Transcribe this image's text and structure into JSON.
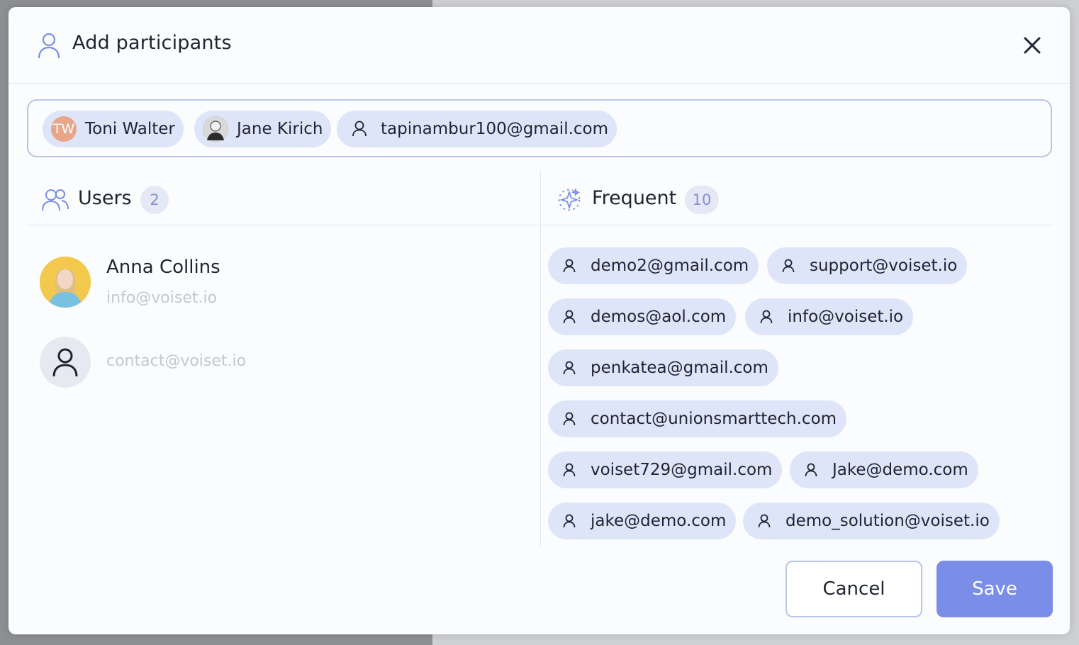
{
  "dialog": {
    "title": "Add participants",
    "close_icon": "close-icon"
  },
  "selected": [
    {
      "initials": "TW",
      "label": "Toni Walter"
    },
    {
      "label": "Jane Kirich"
    },
    {
      "label": "tapinambur100@gmail.com"
    }
  ],
  "users": {
    "title": "Users",
    "count": "2",
    "items": [
      {
        "name": "Anna Collins",
        "email": "info@voiset.io"
      },
      {
        "name": "",
        "email": "contact@voiset.io"
      }
    ]
  },
  "frequent": {
    "title": "Frequent",
    "count": "10",
    "items": [
      "demo2@gmail.com",
      "support@voiset.io",
      "demos@aol.com",
      "info@voiset.io",
      "penkatea@gmail.com",
      "contact@unionsmarttech.com",
      "voiset729@gmail.com",
      "Jake@demo.com",
      "jake@demo.com",
      "demo_solution@voiset.io"
    ]
  },
  "actions": {
    "cancel": "Cancel",
    "save": "Save"
  },
  "colors": {
    "accent": "#7a8de8",
    "chip_bg": "#dfe5f8",
    "border": "#b8c5e6"
  }
}
